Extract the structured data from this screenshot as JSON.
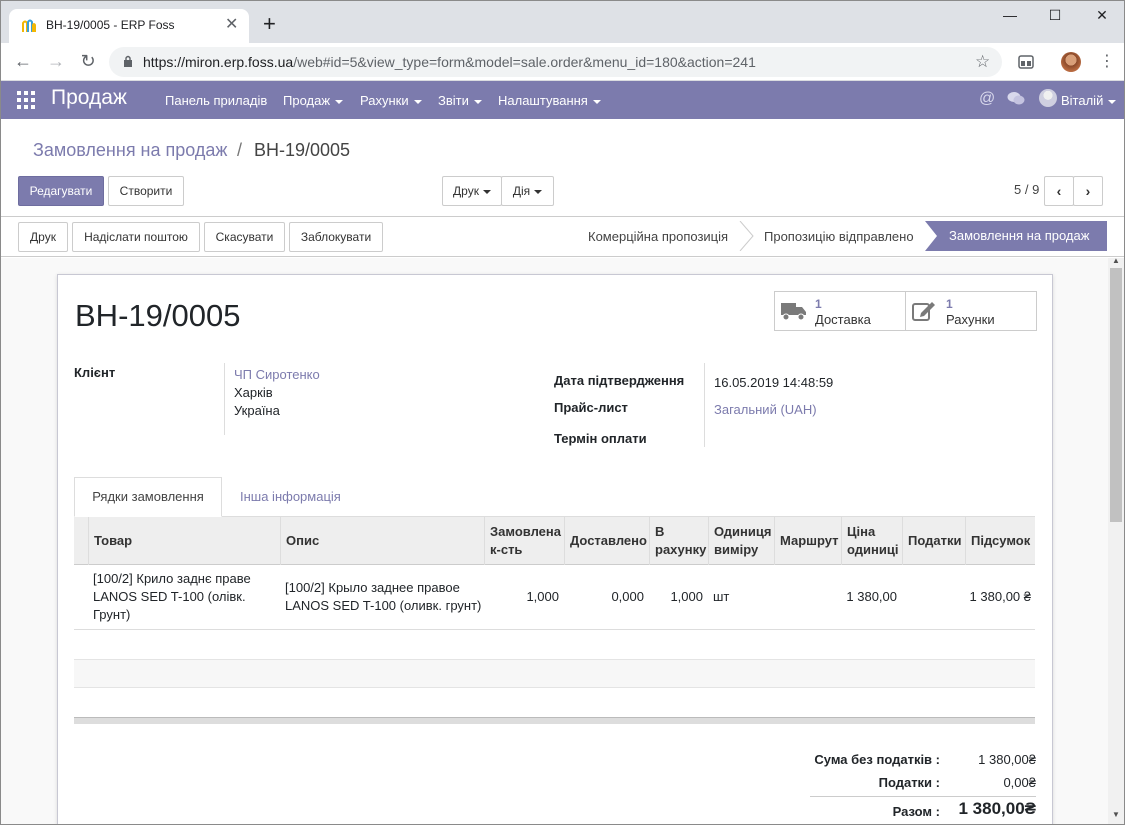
{
  "browser": {
    "tab_title": "ВН-19/0005 - ERP Foss",
    "url_host": "https://miron.erp.foss.ua",
    "url_path": "/web#id=5&view_type=form&model=sale.order&menu_id=180&action=241"
  },
  "navbar": {
    "app_title": "Продаж",
    "menus": [
      "Панель приладів",
      "Продаж",
      "Рахунки",
      "Звіти",
      "Налаштування"
    ],
    "at_icon": "@",
    "user_name": "Віталій"
  },
  "breadcrumb": {
    "parent": "Замовлення на продаж",
    "separator": "/",
    "current": "ВН-19/0005"
  },
  "control": {
    "edit_label": "Редагувати",
    "create_label": "Створити",
    "print_label": "Друк",
    "action_label": "Дія",
    "pager": "5 / 9"
  },
  "header_buttons": [
    "Друк",
    "Надіслати поштою",
    "Скасувати",
    "Заблокувати"
  ],
  "stages": [
    "Комерційна пропозиція",
    "Пропозицію відправлено",
    "Замовлення на продаж"
  ],
  "form": {
    "order_name": "ВН-19/0005",
    "smart_buttons": {
      "delivery": {
        "value": "1",
        "label": "Доставка"
      },
      "invoices": {
        "value": "1",
        "label": "Рахунки"
      }
    },
    "customer_label": "Клієнт",
    "customer_name": "ЧП Сиротенко",
    "customer_city": "Харків",
    "customer_country": "Україна",
    "confirm_date_label": "Дата підтвердження",
    "confirm_date": "16.05.2019 14:48:59",
    "pricelist_label": "Прайс-лист",
    "pricelist": "Загальний (UAH)",
    "payment_term_label": "Термін оплати"
  },
  "tabs": {
    "lines": "Рядки замовлення",
    "other": "Інша інформація"
  },
  "table": {
    "headers": [
      "Товар",
      "Опис",
      "Замовлена к-сть",
      "Доставлено",
      "В рахунку",
      "Одиниця виміру",
      "Маршрут",
      "Ціна одиниці",
      "Податки",
      "Підсумок"
    ],
    "rows": [
      {
        "product": "[100/2] Крило заднє праве LANOS SED T-100 (олівк. Грунт)",
        "description": "[100/2] Крыло заднее правое LANOS SED T-100 (оливк. грунт)",
        "qty": "1,000",
        "delivered": "0,000",
        "invoiced": "1,000",
        "uom": "шт",
        "route": "",
        "price_unit": "1 380,00",
        "taxes": "",
        "subtotal": "1 380,00 ₴"
      }
    ]
  },
  "totals": {
    "untaxed_label": "Сума без податків :",
    "untaxed": "1 380,00₴",
    "taxes_label": "Податки :",
    "taxes": "0,00₴",
    "total_label": "Разом :",
    "total": "1 380,00₴"
  },
  "colors": {
    "brand": "#7c7bad"
  }
}
